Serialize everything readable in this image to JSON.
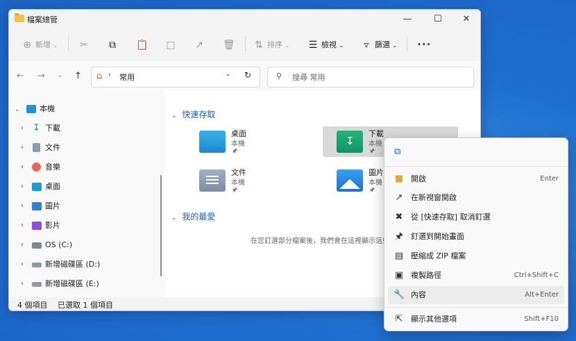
{
  "window": {
    "title": "檔案總管"
  },
  "toolbar": {
    "new_label": "新增",
    "sort_label": "排序",
    "view_label": "檢視",
    "filter_label": "篩選",
    "more_label": "•••"
  },
  "address": {
    "path": "常用",
    "search_placeholder": "搜尋 常用"
  },
  "sidebar": {
    "items": [
      {
        "label": "本機"
      },
      {
        "label": "下載"
      },
      {
        "label": "文件"
      },
      {
        "label": "音樂"
      },
      {
        "label": "桌面"
      },
      {
        "label": "圖片"
      },
      {
        "label": "影片"
      },
      {
        "label": "OS (C:)"
      },
      {
        "label": "新增磁碟區 (D:)"
      },
      {
        "label": "新增磁碟區 (E:)"
      }
    ]
  },
  "main": {
    "quick_access_header": "快速存取",
    "favorites_header": "我的最愛",
    "favorites_empty": "在您釘選部分檔案後，我們會在這裡顯示這些",
    "tiles": [
      {
        "name": "桌面",
        "sub": "本機"
      },
      {
        "name": "下載",
        "sub": "本機"
      },
      {
        "name": "文件",
        "sub": "本機"
      },
      {
        "name": "圖片",
        "sub": "本機"
      }
    ]
  },
  "status": {
    "count": "4 個項目",
    "selected": "已選取 1 個項目"
  },
  "context_menu": {
    "items": [
      {
        "label": "開啟",
        "shortcut": "Enter"
      },
      {
        "label": "在新視窗開啟",
        "shortcut": ""
      },
      {
        "label": "從 [快速存取] 取消釘選",
        "shortcut": ""
      },
      {
        "label": "釘選到開始畫面",
        "shortcut": ""
      },
      {
        "label": "壓縮成 ZIP 檔案",
        "shortcut": ""
      },
      {
        "label": "複製路徑",
        "shortcut": "Ctrl+Shift+C"
      },
      {
        "label": "內容",
        "shortcut": "Alt+Enter"
      },
      {
        "label": "顯示其他選項",
        "shortcut": "Shift+F10"
      }
    ]
  }
}
